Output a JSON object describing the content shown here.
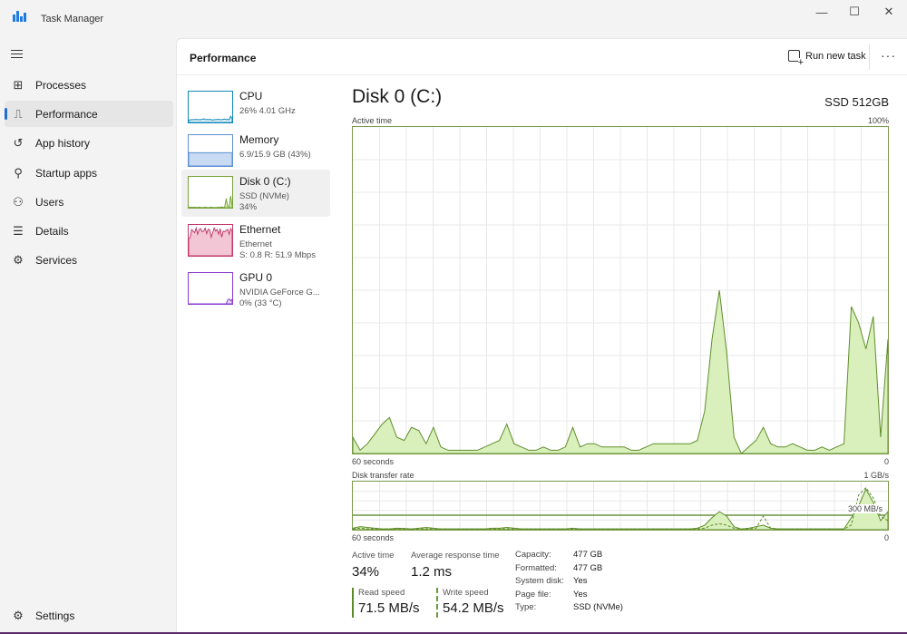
{
  "window": {
    "title": "Task Manager",
    "minimize": "—",
    "maximize": "☐",
    "close": "✕"
  },
  "nav": {
    "items": [
      {
        "label": "Processes",
        "icon": "processes-icon",
        "glyph": "⊞"
      },
      {
        "label": "Performance",
        "icon": "performance-icon",
        "glyph": "⎍"
      },
      {
        "label": "App history",
        "icon": "history-icon",
        "glyph": "↺"
      },
      {
        "label": "Startup apps",
        "icon": "startup-icon",
        "glyph": "⚲"
      },
      {
        "label": "Users",
        "icon": "users-icon",
        "glyph": "⚇"
      },
      {
        "label": "Details",
        "icon": "details-icon",
        "glyph": "☰"
      },
      {
        "label": "Services",
        "icon": "services-icon",
        "glyph": "⚙"
      }
    ],
    "settings": {
      "label": "Settings",
      "glyph": "⚙"
    }
  },
  "header": {
    "title": "Performance",
    "run_task": "Run new task",
    "more": "···"
  },
  "devices": [
    {
      "name": "CPU",
      "line1": "26% 4.01 GHz",
      "line2": ""
    },
    {
      "name": "Memory",
      "line1": "6.9/15.9 GB (43%)",
      "line2": ""
    },
    {
      "name": "Disk 0 (C:)",
      "line1": "SSD (NVMe)",
      "line2": "34%"
    },
    {
      "name": "Ethernet",
      "line1": "Ethernet",
      "line2": "S: 0.8 R: 51.9 Mbps"
    },
    {
      "name": "GPU 0",
      "line1": "NVIDIA GeForce G...",
      "line2": "0% (33 °C)"
    }
  ],
  "detail": {
    "title": "Disk 0 (C:)",
    "model": "SSD 512GB",
    "active_graph": {
      "label": "Active time",
      "max": "100%",
      "left": "60 seconds",
      "right": "0"
    },
    "transfer_graph": {
      "label": "Disk transfer rate",
      "max": "1 GB/s",
      "marker": "300 MB/s",
      "left": "60 seconds",
      "right": "0"
    },
    "stats": {
      "active_time_label": "Active time",
      "active_time": "34%",
      "response_label": "Average response time",
      "response": "1.2 ms",
      "read_label": "Read speed",
      "read": "71.5 MB/s",
      "write_label": "Write speed",
      "write": "54.2 MB/s"
    },
    "props": [
      {
        "key": "Capacity:",
        "value": "477 GB"
      },
      {
        "key": "Formatted:",
        "value": "477 GB"
      },
      {
        "key": "System disk:",
        "value": "Yes"
      },
      {
        "key": "Page file:",
        "value": "Yes"
      },
      {
        "key": "Type:",
        "value": "SSD (NVMe)"
      }
    ]
  },
  "colors": {
    "disk": "#77a33a",
    "disk_fill": "#d9efbc",
    "cpu": "#1189b8",
    "memory": "#5e8fd3",
    "ethernet": "#c23a6a",
    "gpu": "#8a3ad0",
    "accent": "#1f6fd1"
  },
  "chart_data": [
    {
      "type": "area",
      "ylabel": "Active time",
      "ylim": [
        0,
        100
      ],
      "xlabel": "60 seconds",
      "values": [
        5,
        1,
        3,
        6,
        9,
        11,
        5,
        4,
        8,
        7,
        3,
        8,
        2,
        1,
        1,
        1,
        1,
        1,
        2,
        3,
        4,
        9,
        3,
        2,
        1,
        1,
        2,
        1,
        1,
        2,
        8,
        2,
        3,
        3,
        2,
        2,
        2,
        2,
        1,
        1,
        2,
        3,
        3,
        3,
        3,
        3,
        3,
        4,
        13,
        35,
        50,
        31,
        5,
        0,
        2,
        4,
        8,
        3,
        2,
        2,
        3,
        2,
        1,
        1,
        2,
        1,
        2,
        3,
        45,
        40,
        32,
        42,
        5,
        35
      ]
    },
    {
      "type": "line",
      "ylabel": "Disk transfer rate",
      "ylim": [
        0,
        1000
      ],
      "series": [
        {
          "name": "Read speed",
          "values": [
            10,
            20,
            15,
            10,
            5,
            5,
            10,
            8,
            5,
            10,
            15,
            10,
            5,
            5,
            5,
            5,
            5,
            5,
            5,
            10,
            10,
            15,
            10,
            5,
            5,
            5,
            5,
            5,
            5,
            5,
            10,
            5,
            5,
            5,
            5,
            5,
            5,
            5,
            5,
            5,
            5,
            5,
            5,
            5,
            5,
            5,
            5,
            10,
            30,
            80,
            120,
            90,
            20,
            5,
            10,
            20,
            30,
            10,
            5,
            5,
            5,
            5,
            5,
            5,
            5,
            5,
            5,
            5,
            80,
            160,
            270,
            180,
            60,
            120
          ]
        },
        {
          "name": "Write speed",
          "values": [
            5,
            10,
            5,
            5,
            5,
            5,
            5,
            5,
            5,
            5,
            5,
            5,
            5,
            5,
            5,
            5,
            5,
            5,
            5,
            5,
            5,
            5,
            5,
            5,
            5,
            5,
            5,
            5,
            5,
            5,
            5,
            5,
            5,
            5,
            5,
            5,
            5,
            5,
            5,
            5,
            5,
            5,
            5,
            5,
            5,
            5,
            5,
            5,
            10,
            30,
            40,
            30,
            10,
            5,
            5,
            10,
            90,
            10,
            5,
            5,
            5,
            5,
            5,
            5,
            5,
            5,
            5,
            5,
            30,
            230,
            280,
            210,
            90,
            60
          ]
        }
      ]
    }
  ]
}
